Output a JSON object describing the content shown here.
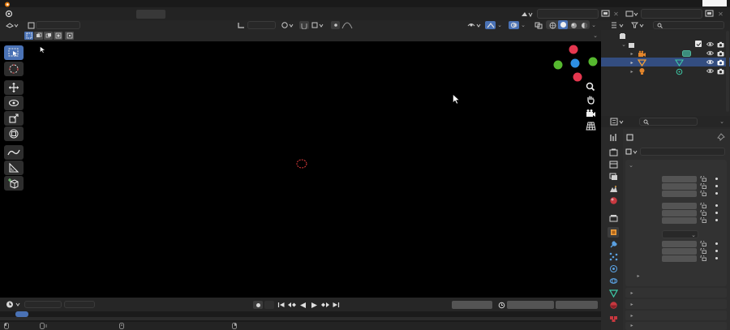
{
  "colors": {
    "accent": "#4a72b5",
    "gizmo_x": "#e5374f",
    "gizmo_y": "#56b82f",
    "gizmo_z": "#2d8fe3",
    "selection": "#334d80",
    "object_origin": "#e03b3b"
  },
  "topbar": {
    "icons": [
      "blender-logo-icon",
      "render-icon"
    ]
  },
  "viewport": {
    "header_icons": [
      "editor-type-icon",
      "view-object-icon",
      "transform-orientation-icon",
      "pivot-icon",
      "snap-icon",
      "proportional-icon",
      "visibility-icon",
      "gizmo-icon",
      "overlay-icon",
      "xray-icon",
      "shading-solid-icon",
      "shading-material-icon",
      "shading-rendered-icon"
    ],
    "tools": [
      "select-box-icon",
      "cursor-icon",
      "move-icon",
      "rotate-icon",
      "scale-icon",
      "transform-icon",
      "annotate-icon",
      "measure-icon",
      "add-cube-icon"
    ],
    "nav_icons": [
      "zoom-icon",
      "pan-icon",
      "camera-view-icon",
      "perspective-grid-icon"
    ]
  },
  "outliner": {
    "rows": [
      {
        "name": "scene-collection"
      },
      {
        "name": "collection"
      },
      {
        "name": "camera-object"
      },
      {
        "name": "cube-object",
        "selected": true
      },
      {
        "name": "light-object"
      }
    ]
  },
  "properties": {
    "tabs": [
      "tool-tab",
      "render-tab",
      "output-tab",
      "view-layer-tab",
      "scene-tab",
      "world-tab",
      "collection-tab",
      "object-tab",
      "modifier-tab",
      "particles-tab",
      "physics-tab",
      "constraints-tab",
      "data-tab",
      "material-tab",
      "texture-tab"
    ]
  },
  "timeline": {
    "playback_icons": [
      "jump-start-icon",
      "prev-keyframe-icon",
      "play-reverse-icon",
      "play-icon",
      "next-keyframe-icon",
      "jump-end-icon"
    ]
  }
}
